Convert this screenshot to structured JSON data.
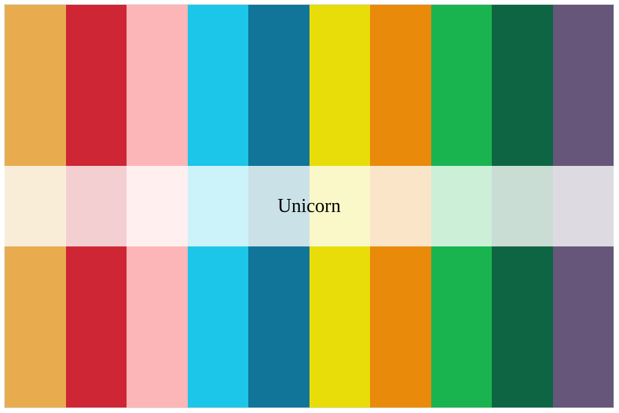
{
  "palette": {
    "name": "Unicorn",
    "colors": [
      "#E8AC4E",
      "#CE2634",
      "#FDB6B8",
      "#1BC6E8",
      "#107598",
      "#E8DD09",
      "#E98A0B",
      "#19B44F",
      "#0E6543",
      "#65567A"
    ]
  }
}
